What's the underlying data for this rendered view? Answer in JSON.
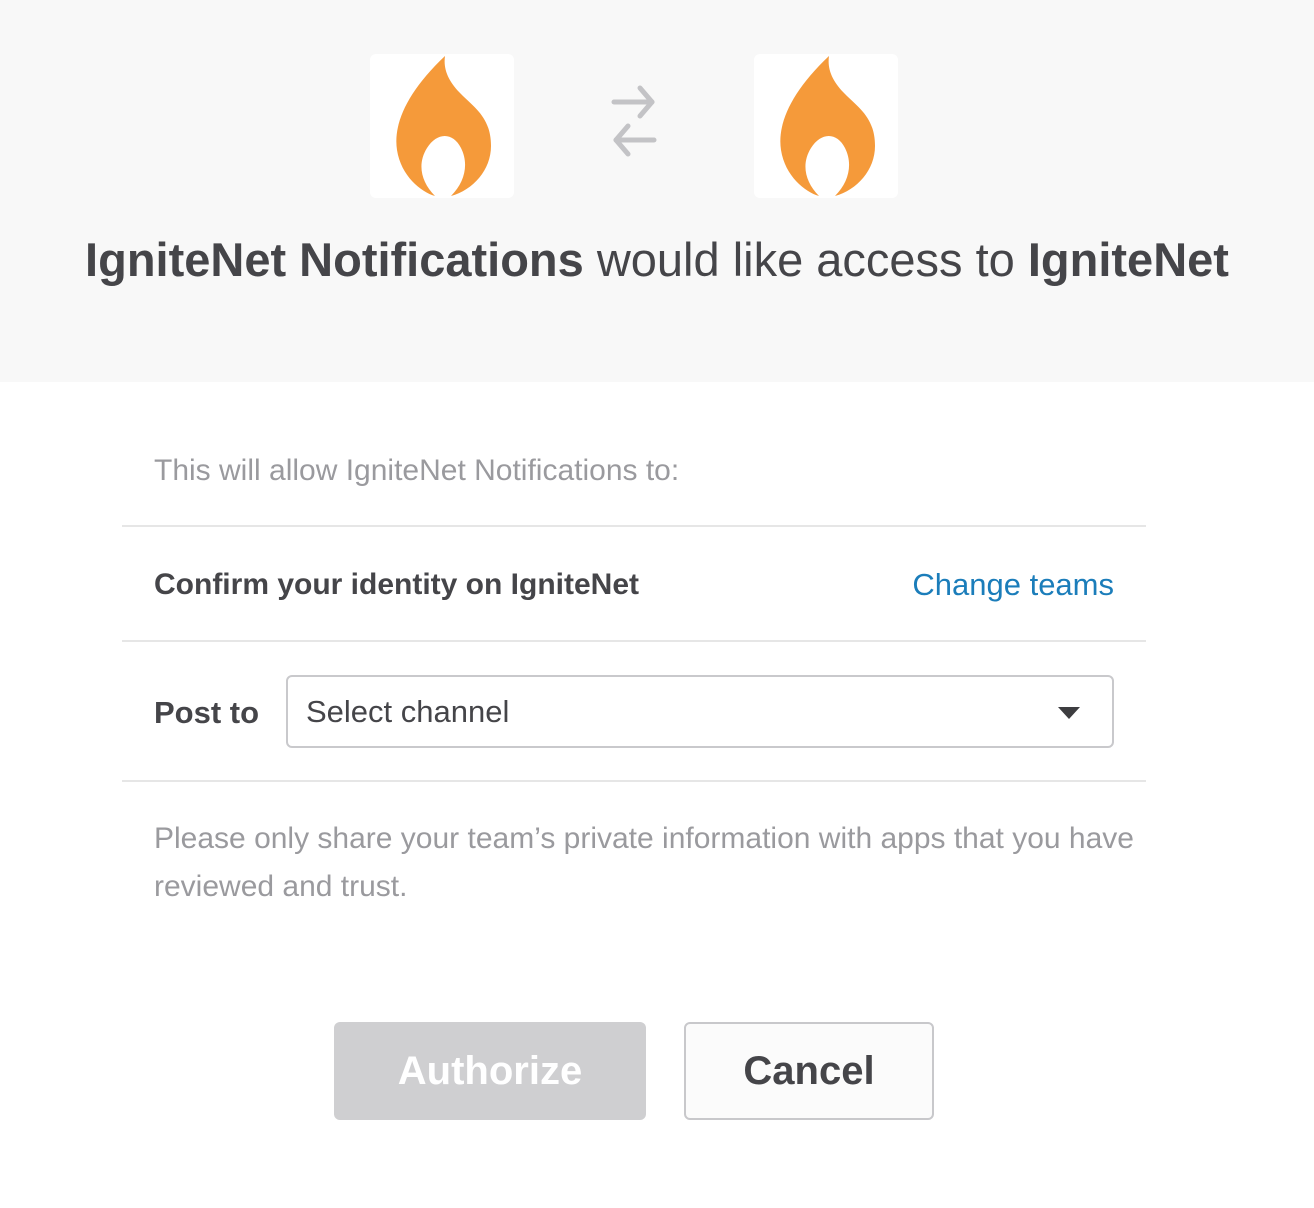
{
  "header": {
    "app_logo_icon": "flame-icon",
    "exchange_icon": "exchange-arrows-icon",
    "workspace_logo_icon": "flame-icon",
    "app_name": "IgniteNet Notifications",
    "request_text": " would like access to ",
    "workspace_name": "IgniteNet",
    "logo_color": "#f59a3a"
  },
  "permissions": {
    "intro": "This will allow IgniteNet Notifications to:",
    "identity_label": "Confirm your identity on IgniteNet",
    "change_teams_label": "Change teams",
    "post_to_label": "Post to",
    "channel_select_value": "Select channel"
  },
  "notice": "Please only share your team’s private information with apps that you have reviewed and trust.",
  "actions": {
    "authorize_label": "Authorize",
    "cancel_label": "Cancel"
  },
  "colors": {
    "link": "#1b7dba",
    "authorize_disabled_bg": "#cfcfd1",
    "header_bg": "#f8f8f8"
  }
}
